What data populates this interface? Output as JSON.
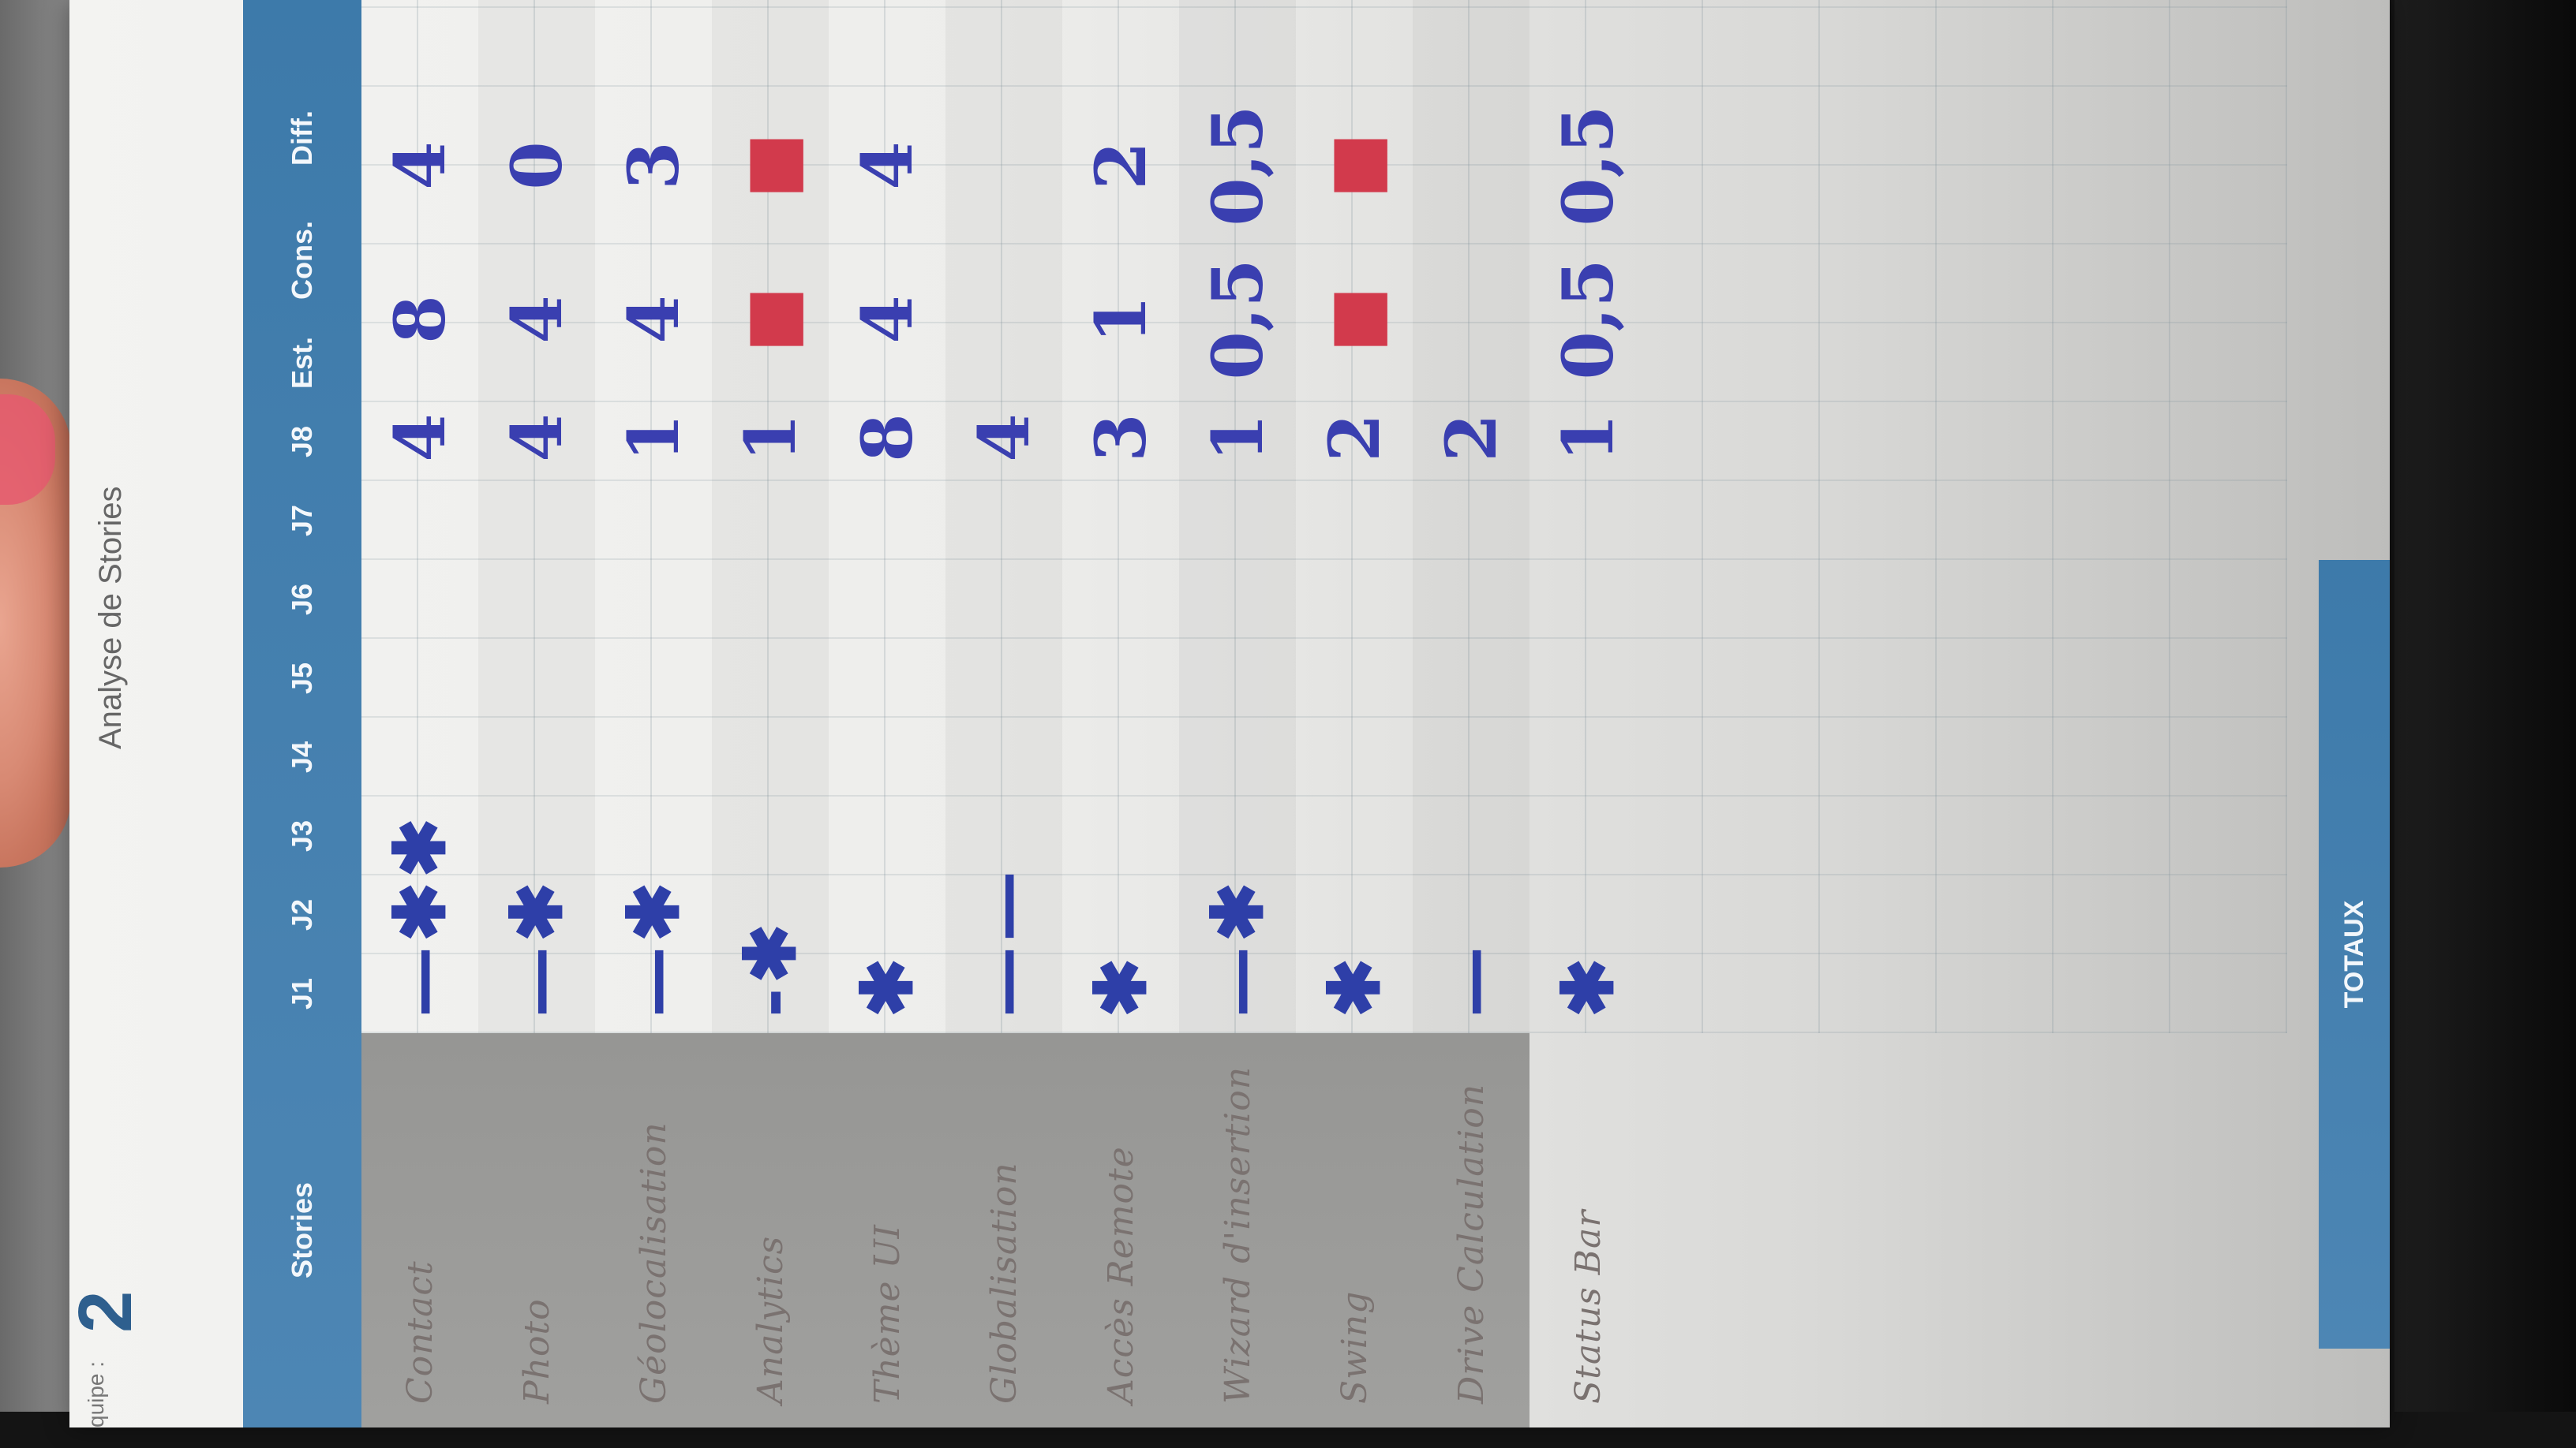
{
  "sheet": {
    "team_label": "quipe :",
    "team_number": "2",
    "title": "Analyse de Stories",
    "totals_label": "TOTAUX"
  },
  "columns": [
    "Stories",
    "J1",
    "J2",
    "J3",
    "J4",
    "J5",
    "J6",
    "J7",
    "J8",
    "Est.",
    "Cons.",
    "Diff."
  ],
  "rows": [
    {
      "story": "Contact",
      "marks": "—✱✱",
      "est": "4",
      "cons": "8",
      "diff": "4"
    },
    {
      "story": "Photo",
      "marks": "—✱",
      "est": "4",
      "cons": "4",
      "diff": "0"
    },
    {
      "story": "Géolocalisation",
      "marks": "—✱",
      "est": "1",
      "cons": "4",
      "diff": "3"
    },
    {
      "story": "Analytics",
      "marks": "-✱",
      "est": "1",
      "cons": "■",
      "diff": "■"
    },
    {
      "story": "Thème UI",
      "marks": "✱",
      "est": "8",
      "cons": "4",
      "diff": "4"
    },
    {
      "story": "Globalisation",
      "marks": "——",
      "est": "4",
      "cons": "",
      "diff": ""
    },
    {
      "story": "Accès Remote",
      "marks": "✱",
      "est": "3",
      "cons": "1",
      "diff": "2"
    },
    {
      "story": "Wizard d'insertion",
      "marks": "—✱",
      "est": "1",
      "cons": "0,5",
      "diff": "0,5"
    },
    {
      "story": "Swing",
      "marks": "✱",
      "est": "2",
      "cons": "■",
      "diff": "■"
    },
    {
      "story": "Drive Calculation",
      "marks": "—",
      "est": "2",
      "cons": "",
      "diff": ""
    },
    {
      "story": "Status Bar",
      "marks": "✱",
      "est": "1",
      "cons": "0,5",
      "diff": "0,5"
    }
  ],
  "colors": {
    "header_blue": "#4d86b4",
    "ink_blue": "#3a3fb0",
    "ink_red": "#d23a4c"
  }
}
